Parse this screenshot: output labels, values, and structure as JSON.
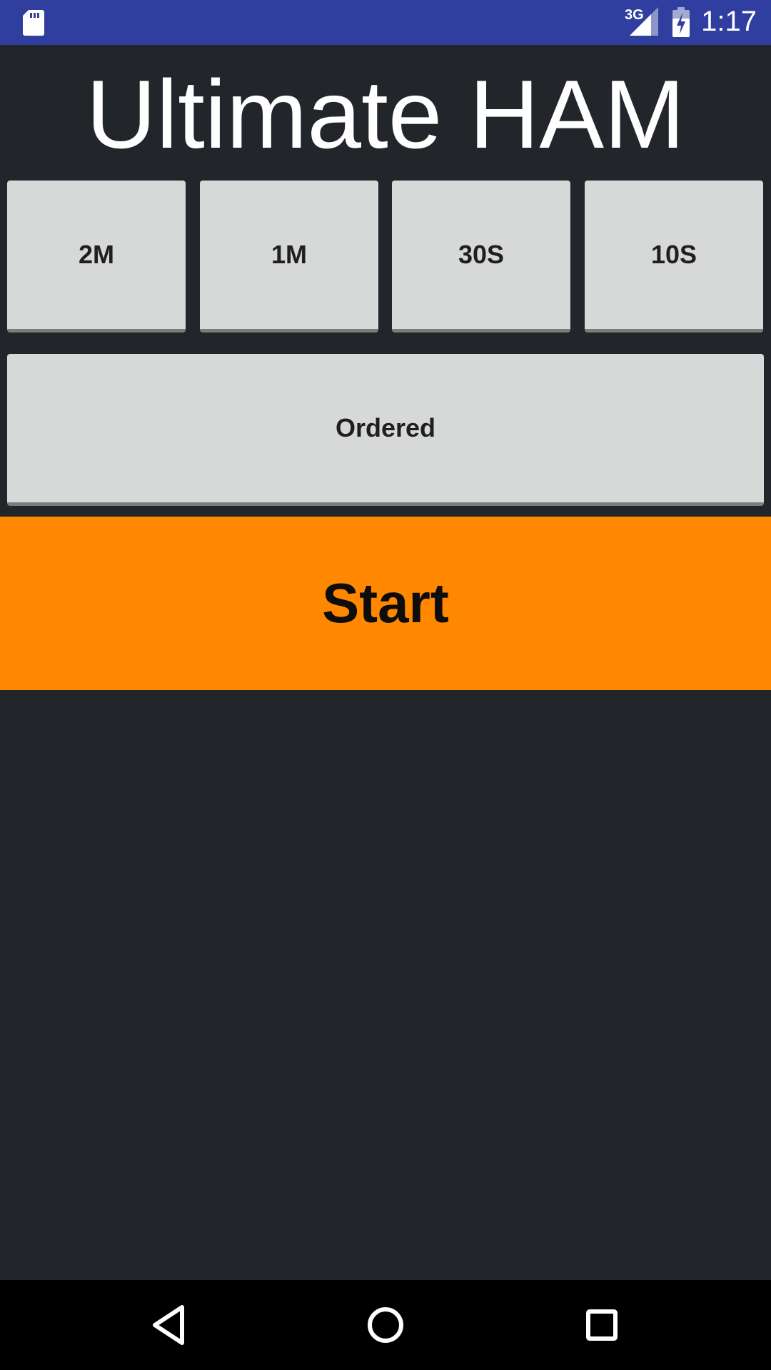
{
  "status_bar": {
    "network": "3G",
    "time": "1:17",
    "icons": [
      "sd-card-icon",
      "signal-icon",
      "battery-charging-icon"
    ]
  },
  "app": {
    "title": "Ultimate HAM"
  },
  "duration_buttons": [
    {
      "label": "2M"
    },
    {
      "label": "1M"
    },
    {
      "label": "30S"
    },
    {
      "label": "10S"
    }
  ],
  "order_button": {
    "label": "Ordered"
  },
  "start_button": {
    "label": "Start"
  },
  "nav_bar": {
    "icons": [
      "back-icon",
      "home-icon",
      "recents-icon"
    ]
  },
  "colors": {
    "status_bar": "#303f9f",
    "background": "#22262a",
    "button": "#d7d8d8",
    "accent": "#ff8800"
  }
}
